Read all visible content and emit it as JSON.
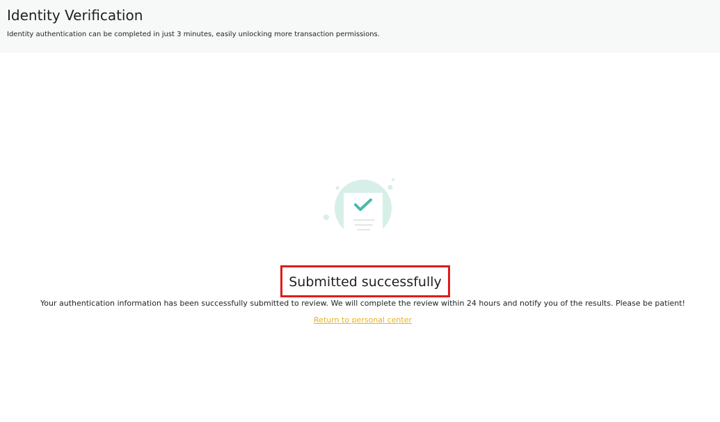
{
  "header": {
    "title": "Identity Verification",
    "subtitle": "Identity authentication can be completed in just 3 minutes, easily unlocking more transaction permissions."
  },
  "result": {
    "icon": "document-checkmark-icon",
    "title": "Submitted successfully",
    "message": "Your authentication information has been successfully submitted to review. We will complete the review within 24 hours and notify you of the results. Please be patient!",
    "return_link_label": "Return to personal center"
  },
  "colors": {
    "header_bg": "#f7f8f8",
    "accent_link": "#e8b21b",
    "highlight_border": "#e01b1b",
    "illustration_circle": "#d7efe9",
    "check_color": "#4ab9a8"
  }
}
